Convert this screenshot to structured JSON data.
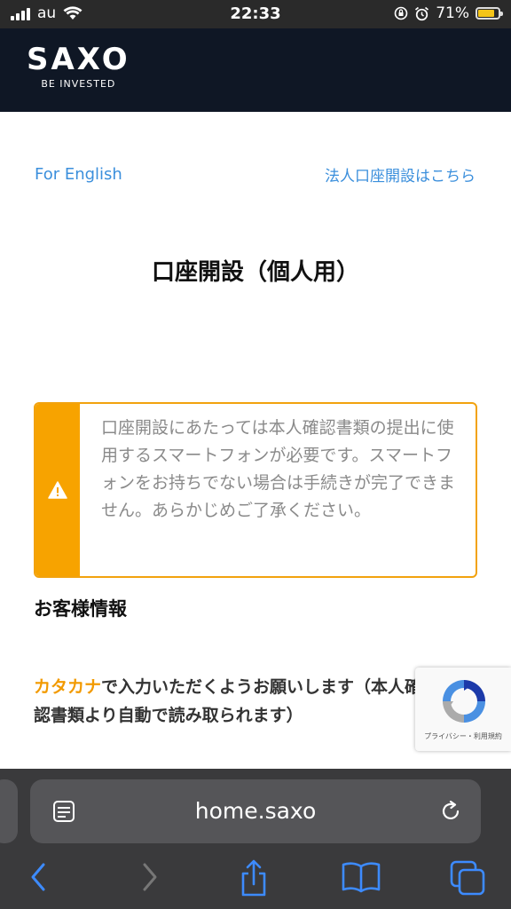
{
  "status_bar": {
    "carrier": "au",
    "time": "22:33",
    "battery_percent": "71%",
    "battery_level": 0.71,
    "battery_color": "#f5c518"
  },
  "header": {
    "logo_main": "SAXO",
    "logo_tagline": "BE INVESTED"
  },
  "links": {
    "english": "For English",
    "corporate": "法人口座開設はこちら"
  },
  "page_title": "口座開設（個人用）",
  "notice": {
    "icon": "warning-icon",
    "text": "口座開設にあたっては本人確認書類の提出に使用するスマートフォンが必要です。スマートフォンをお持ちでない場合は手続きが完了できません。あらかじめご了承ください。",
    "accent_color": "#f7a300"
  },
  "section": {
    "title": "お客様情報",
    "katakana_accent": "カタカナ",
    "katakana_note": "で入力いただくようお願いします（本人確認書類より自動で読み取られます）"
  },
  "recaptcha": {
    "terms": "プライバシー・利用規約"
  },
  "browser": {
    "url": "home.saxo",
    "toolbar": [
      "back-icon",
      "forward-icon",
      "share-icon",
      "bookmarks-icon",
      "tabs-icon"
    ]
  }
}
